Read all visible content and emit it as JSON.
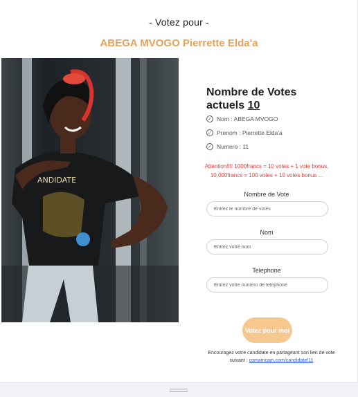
{
  "header": {
    "eyebrow": "- Votez pour -",
    "candidate_name": "ABEGA MVOGO Pierrette Elda'a"
  },
  "votes": {
    "title": "Nombre de Votes actuels",
    "count": "10"
  },
  "info": [
    {
      "icon": "check-circle-icon",
      "text": "Nom : ABEGA MVOGO"
    },
    {
      "icon": "check-circle-icon",
      "text": "Prenom : Pierrette Elda'a"
    },
    {
      "icon": "check-circle-icon",
      "text": "Numero : 11"
    }
  ],
  "promo_text": "Attention!!!! 1000francs = 10 votes + 1 vote bonus, 10,000francs = 100 votes + 10 votes bonus ...",
  "form": {
    "votes_label": "Nombre de Vote",
    "votes_placeholder": "Entrez le nombre de votes",
    "name_label": "Nom",
    "name_placeholder": "Entrez votre nom",
    "phone_label": "Telephone",
    "phone_placeholder": "Entrez votre numero de telephone",
    "submit_label": "Votez pour moi"
  },
  "share": {
    "text": "Encouragez votre candidate en partageant son lien de vote suivant :",
    "link": "comamcam.com/candidate/11"
  },
  "colors": {
    "accent": "#e8a159",
    "button": "#f6c890",
    "promo": "#e53935",
    "link": "#2a5bd7"
  }
}
